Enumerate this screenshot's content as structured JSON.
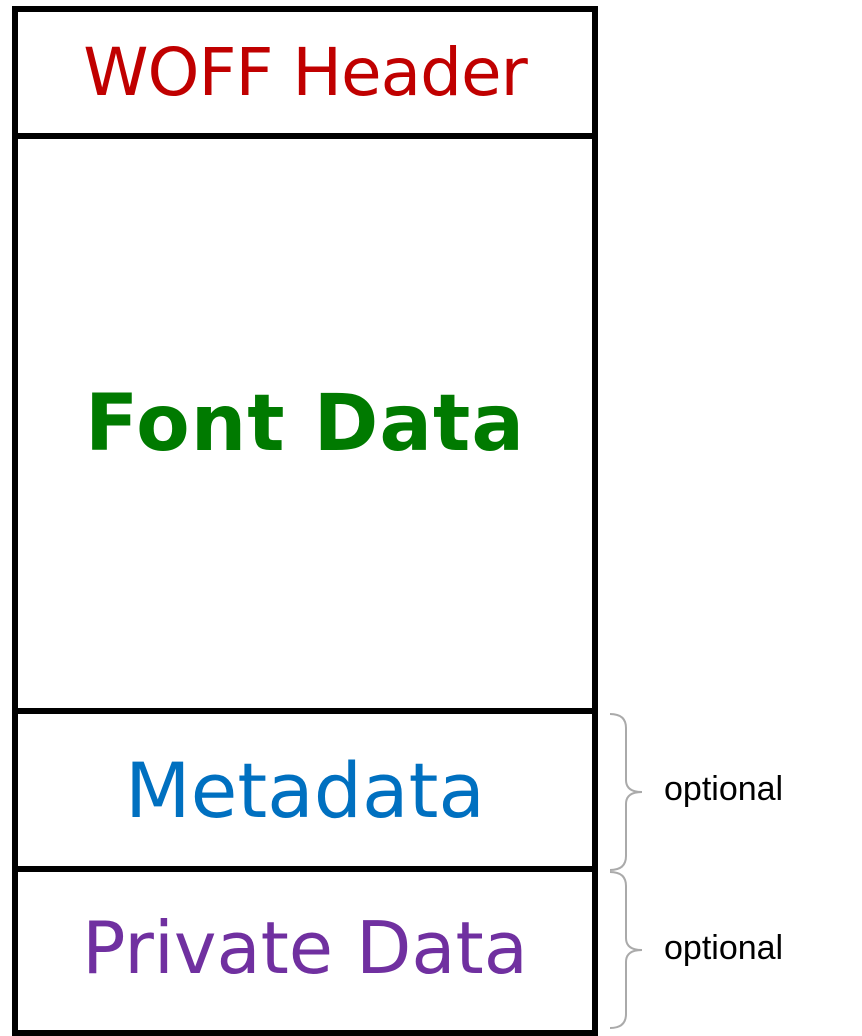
{
  "sections": [
    {
      "label": "WOFF Header",
      "color": "#c00000"
    },
    {
      "label": "Font Data",
      "color": "#007a00"
    },
    {
      "label": "Metadata",
      "color": "#0070c0"
    },
    {
      "label": "Private Data",
      "color": "#7030a0"
    }
  ],
  "annotations": {
    "metadata": "optional",
    "private_data": "optional"
  },
  "colors": {
    "border": "#000000",
    "brace": "#aaaaaa"
  }
}
